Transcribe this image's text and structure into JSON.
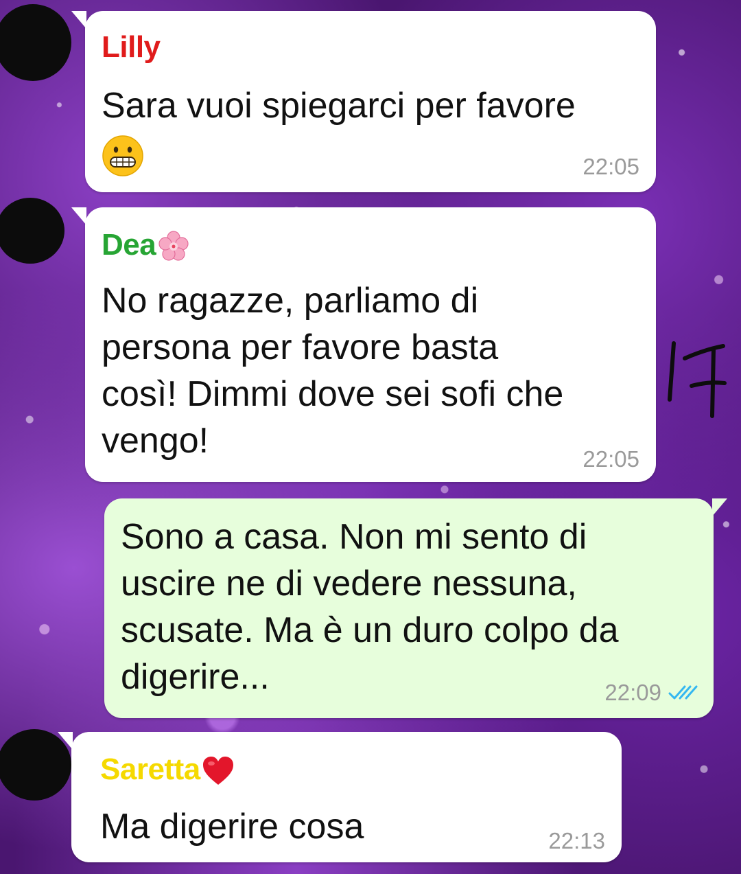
{
  "chat": {
    "colors": {
      "bubble_in": "#ffffff",
      "bubble_out": "#e7fedc",
      "timestamp": "#9a9a9a",
      "read_ticks": "#34b7f1"
    },
    "messages": [
      {
        "sender": "Lilly",
        "sender_color": "#e01b1b",
        "lines": [
          "Sara vuoi spiegarci per favore"
        ],
        "trailing_emoji": "grimacing-face-emoji",
        "time": "22:05"
      },
      {
        "sender": "Dea",
        "sender_color": "#27a534",
        "sender_emoji": "cherry-blossom-icon",
        "lines": [
          "No ragazze, parliamo di",
          "persona per favore basta",
          "così! Dimmi dove sei sofi che",
          "vengo!"
        ],
        "time": "22:05"
      },
      {
        "outgoing": true,
        "lines": [
          "Sono a casa. Non mi sento di",
          "uscire ne di vedere nessuna,",
          "scusate. Ma è un duro colpo da",
          "digerire..."
        ],
        "time": "22:09",
        "status_icon": "double-check-icon"
      },
      {
        "sender": "Saretta",
        "sender_color": "#f5d900",
        "sender_emoji": "red-heart-icon",
        "lines": [
          "Ma digerire cosa"
        ],
        "time": "22:13"
      }
    ],
    "annotation": "17"
  }
}
